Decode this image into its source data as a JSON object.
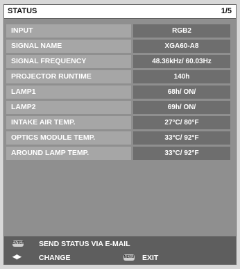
{
  "window": {
    "title": "STATUS",
    "page": "1/5"
  },
  "rows": [
    {
      "label": "INPUT",
      "value": "RGB2"
    },
    {
      "label": "SIGNAL NAME",
      "value": "XGA60-A8"
    },
    {
      "label": "SIGNAL FREQUENCY",
      "value": "48.36kHz/ 60.03Hz"
    },
    {
      "label": "PROJECTOR RUNTIME",
      "value": "140h"
    },
    {
      "label": "LAMP1",
      "value": "68h/ ON/"
    },
    {
      "label": "LAMP2",
      "value": "69h/ ON/"
    },
    {
      "label": "INTAKE AIR TEMP.",
      "value": "27°C/ 80°F"
    },
    {
      "label": "OPTICS MODULE TEMP.",
      "value": "33°C/ 92°F"
    },
    {
      "label": "AROUND LAMP TEMP.",
      "value": "33°C/ 92°F"
    }
  ],
  "footer": {
    "enter_key": "ENTER",
    "send_label": "SEND STATUS VIA E-MAIL",
    "change_label": "CHANGE",
    "menu_key": "MENU",
    "exit_label": "EXIT"
  }
}
